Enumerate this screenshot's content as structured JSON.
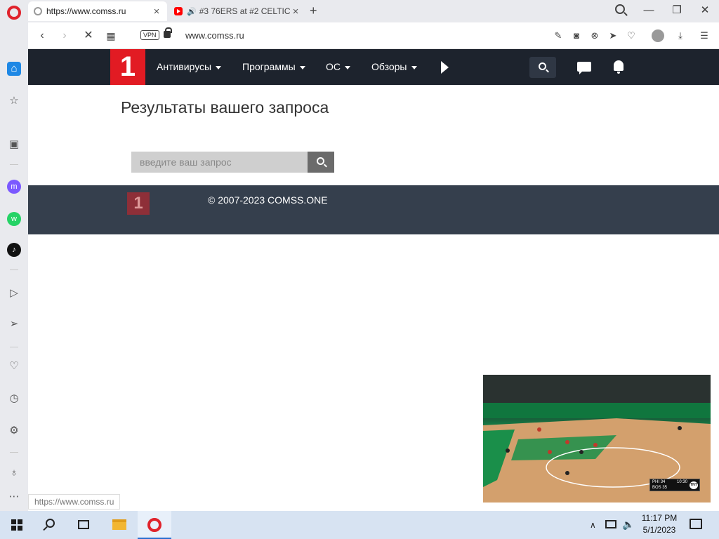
{
  "browser": {
    "tabs": [
      {
        "title": "https://www.comss.ru",
        "active": true
      },
      {
        "title": "#3 76ERS at #2 CELTICS",
        "active": false,
        "playing_audio": true
      }
    ],
    "url": "www.comss.ru",
    "vpn_label": "VPN",
    "status_url": "https://www.comss.ru"
  },
  "icons": {
    "opera": "opera-logo-icon",
    "home": "home-icon",
    "bookmarks": "star-icon",
    "shopping": "shopping-bag-icon",
    "messenger": "messenger-icon",
    "whatsapp": "whatsapp-icon",
    "tiktok": "tiktok-icon",
    "player": "player-icon",
    "send": "send-icon",
    "favorites": "heart-icon",
    "history": "history-icon",
    "settings": "gear-icon",
    "tips": "bulb-icon",
    "more": "more-icon"
  },
  "site": {
    "logo_text": "1",
    "nav": [
      "Антивирусы",
      "Программы",
      "ОС",
      "Обзоры"
    ],
    "results_title": "Результаты вашего запроса",
    "search_placeholder": "введите ваш запрос",
    "footer_copyright": "© 2007-2023 COMSS.ONE",
    "colors": {
      "header_bg": "#1d232d",
      "logo_red": "#e21b23",
      "footer_bg": "#353f4d"
    }
  },
  "video": {
    "scorebug": {
      "team1": "PHI",
      "score1": "34",
      "team2": "BOS",
      "score2": "35",
      "clock": "10:30",
      "network": "TNT"
    }
  },
  "taskbar": {
    "time": "11:17 PM",
    "date": "5/1/2023"
  }
}
